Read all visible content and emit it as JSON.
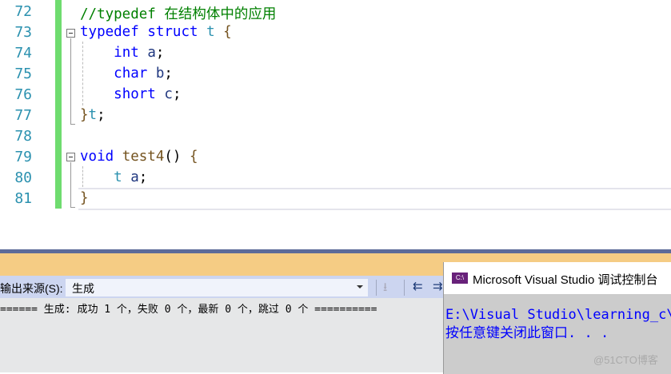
{
  "editor": {
    "line_numbers": [
      "72",
      "73",
      "74",
      "75",
      "76",
      "77",
      "78",
      "79",
      "80",
      "81"
    ],
    "lines": {
      "l72": {
        "comment": "//typedef 在结构体中的应用"
      },
      "l73": {
        "kw1": "typedef",
        "kw2": "struct",
        "name": "t",
        "brace": "{"
      },
      "l74": {
        "type": "int",
        "var": "a",
        "semi": ";"
      },
      "l75": {
        "type": "char",
        "var": "b",
        "semi": ";"
      },
      "l76": {
        "type": "short",
        "var": "c",
        "semi": ";"
      },
      "l77": {
        "brace": "}",
        "name": "t",
        "semi": ";"
      },
      "l79": {
        "type": "void",
        "fn": "test4",
        "paren": "()",
        "brace": "{"
      },
      "l80": {
        "type": "t",
        "var": "a",
        "semi": ";"
      },
      "l81": {
        "brace": "}"
      }
    }
  },
  "output": {
    "source_label": "输出来源(S):",
    "source_value": "生成",
    "text": "====== 生成: 成功 1 个，失败 0 个，最新 0 个，跳过 0 个 =========="
  },
  "console": {
    "icon_text": "C:\\",
    "title": "Microsoft Visual Studio 调试控制台",
    "line1": "E:\\Visual Studio\\learning_c\\",
    "line2": "按任意键关闭此窗口. . ."
  },
  "watermark": "@51CTO博客"
}
